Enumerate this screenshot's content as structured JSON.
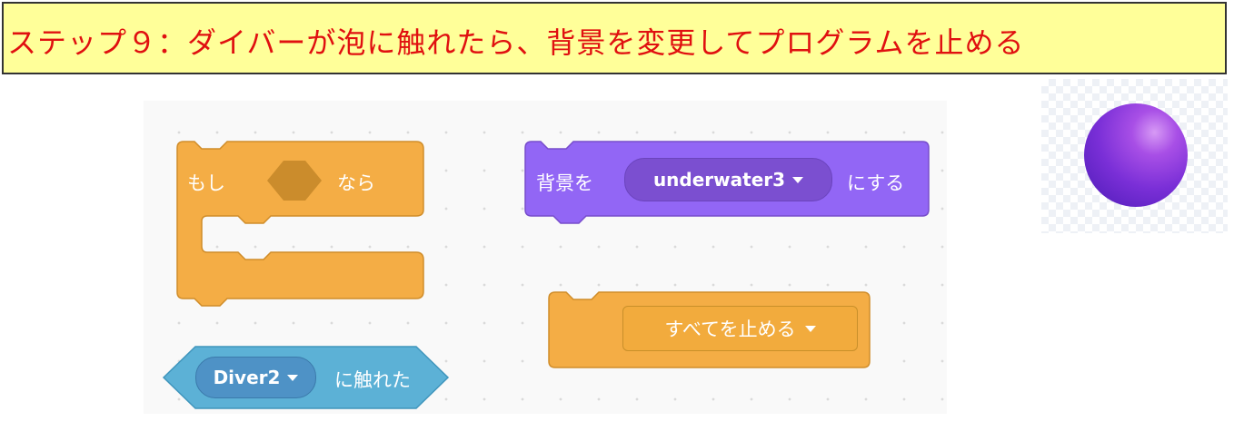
{
  "title": "ステップ９：ダイバーが泡に触れたら、背景を変更してプログラムを止める",
  "colors": {
    "title_text": "#e01010",
    "title_background": "#ffff99",
    "control_block": "#f4ad45",
    "looks_block": "#9266f5",
    "sensing_block": "#5cb1d6"
  },
  "blocks": {
    "if_block": {
      "if_label": "もし",
      "then_label": "なら"
    },
    "switch_backdrop": {
      "prefix": "背景を",
      "backdrop_value": "underwater3",
      "suffix": "にする"
    },
    "stop_block": {
      "option_value": "すべてを止める"
    },
    "touching_block": {
      "target_value": "Diver2",
      "suffix": "に触れた"
    }
  },
  "sprite_thumbnail": {
    "icon": "purple-bubble"
  }
}
